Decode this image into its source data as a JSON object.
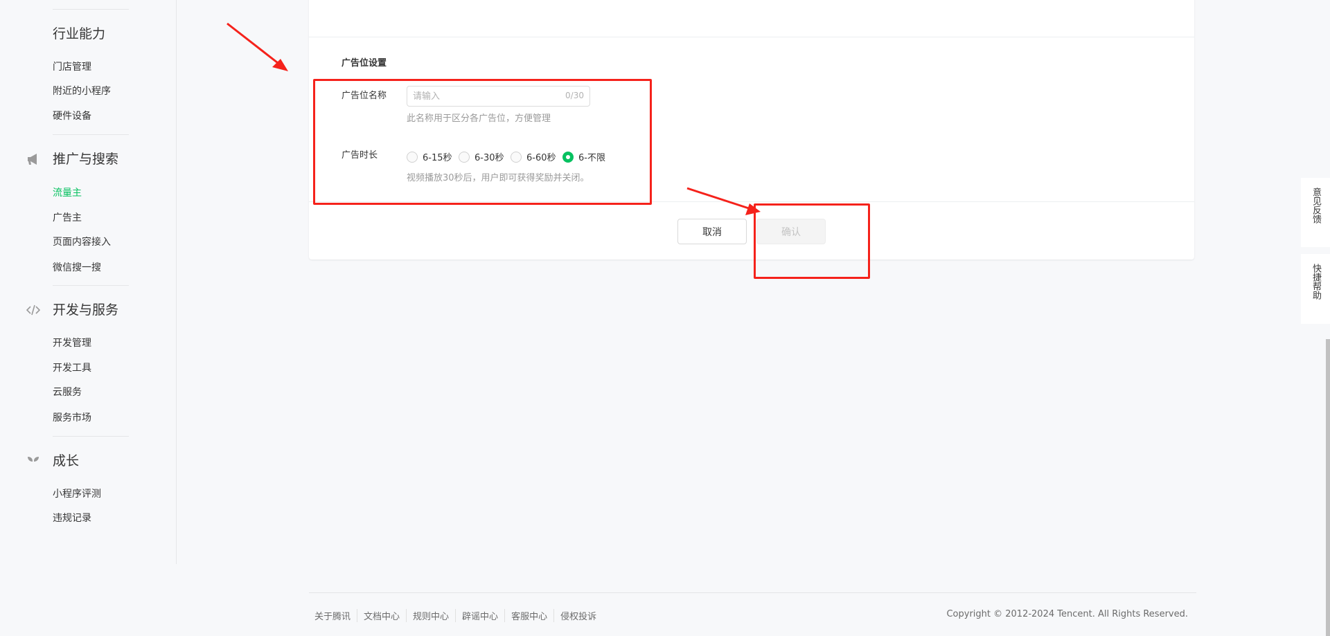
{
  "sidebar": {
    "sections": [
      {
        "title": "行业能力",
        "items": [
          "门店管理",
          "附近的小程序",
          "硬件设备"
        ]
      },
      {
        "title": "推广与搜索",
        "icon": "megaphone-icon",
        "items": [
          "流量主",
          "广告主",
          "页面内容接入",
          "微信搜一搜"
        ],
        "active": "流量主"
      },
      {
        "title": "开发与服务",
        "icon": "code-icon",
        "items": [
          "开发管理",
          "开发工具",
          "云服务",
          "服务市场"
        ]
      },
      {
        "title": "成长",
        "icon": "sprout-icon",
        "items": [
          "小程序评测",
          "违规记录"
        ]
      }
    ]
  },
  "form": {
    "section_title": "广告位设置",
    "name_label": "广告位名称",
    "name_placeholder": "请输入",
    "name_value": "",
    "name_count": "0/30",
    "name_hint": "此名称用于区分各广告位，方便管理",
    "duration_label": "广告时长",
    "duration_options": [
      "6-15秒",
      "6-30秒",
      "6-60秒",
      "6-不限"
    ],
    "duration_selected": "6-不限",
    "duration_hint": "视频播放30秒后，用户即可获得奖励并关闭。"
  },
  "buttons": {
    "cancel": "取消",
    "confirm": "确认"
  },
  "float": {
    "feedback": "意见反馈",
    "help": "快捷帮助"
  },
  "footer": {
    "links": [
      "关于腾讯",
      "文档中心",
      "规则中心",
      "辟谣中心",
      "客服中心",
      "侵权投诉"
    ],
    "copyright": "Copyright © 2012-2024 Tencent. All Rights Reserved."
  },
  "colors": {
    "accent": "#07c160",
    "annotation": "#f5221b"
  }
}
